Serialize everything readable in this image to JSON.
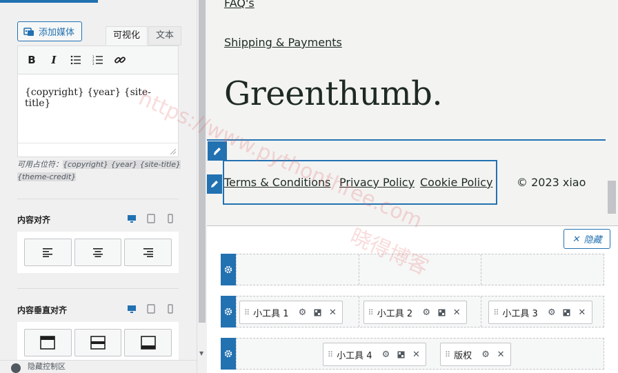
{
  "editor": {
    "add_media": "添加媒体",
    "tab_visual": "可视化",
    "tab_text": "文本",
    "content": "{copyright} {year} {site-title}",
    "placeholder_label": "可用占位符：",
    "placeholder_values": "{copyright} {year} {site-title} {theme-credit}"
  },
  "sections": {
    "content_align": "内容对齐",
    "content_valign": "内容垂直对齐",
    "hide_controls": "隐藏控制区"
  },
  "preview": {
    "link_faq": "FAQ's",
    "link_shipping": "Shipping & Payments",
    "brand": "Greenthumb.",
    "footer_links": [
      "Terms & Conditions",
      "Privacy Policy",
      "Cookie Policy"
    ],
    "copyright": "© 2023 xiao"
  },
  "builder": {
    "hide_button": "隐藏",
    "row2_widgets": [
      "小工具 1",
      "小工具 2",
      "小工具 3"
    ],
    "row3_widgets": [
      "小工具 4",
      "版权"
    ]
  },
  "watermark": {
    "url": "https://www.pythonthree.com",
    "name": "晓得博客"
  },
  "colors": {
    "accent": "#2271b1",
    "brand_text": "#1e2a23",
    "panel_bg": "#f0f0f1",
    "watermark": "#e25a5a"
  }
}
